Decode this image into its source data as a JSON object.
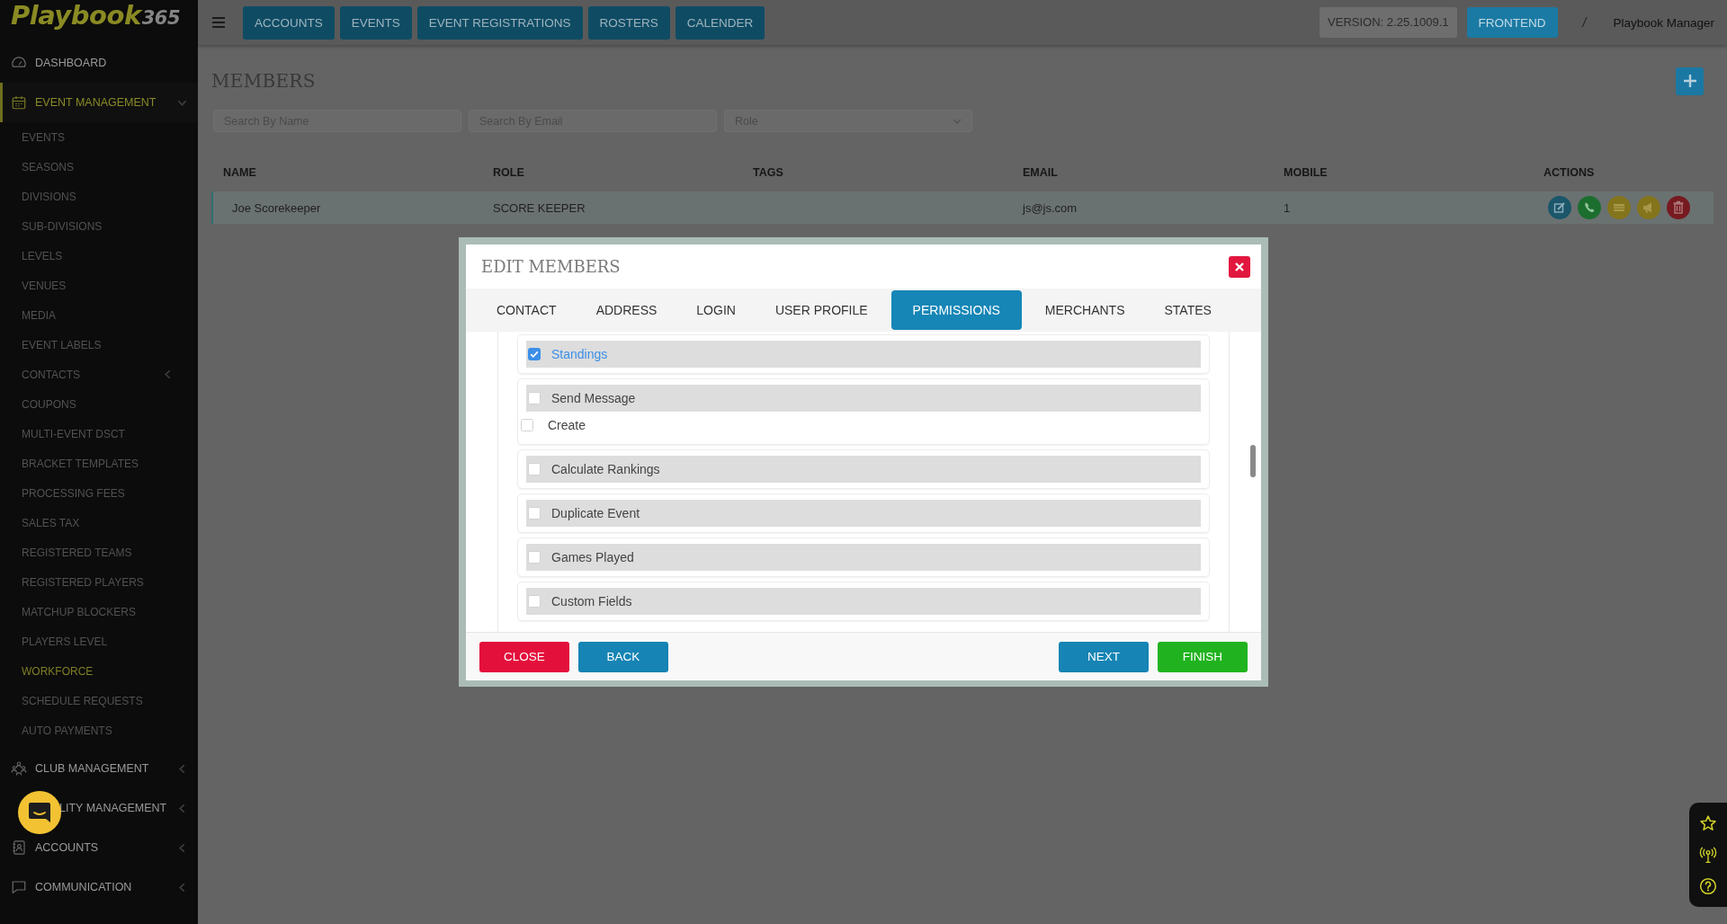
{
  "sidebar": {
    "logo": {
      "name": "Playbook",
      "number": "365"
    },
    "items": [
      {
        "kind": "link",
        "label": "DASHBOARD",
        "selected": false
      },
      {
        "kind": "group",
        "label": "EVENT MANAGEMENT",
        "selected": true,
        "expanded": true,
        "children": [
          {
            "kind": "link",
            "label": "EVENTS",
            "selected": false
          },
          {
            "kind": "link",
            "label": "SEASONS",
            "selected": false
          },
          {
            "kind": "link",
            "label": "DIVISIONS",
            "selected": false
          },
          {
            "kind": "link",
            "label": "SUB-DIVISIONS",
            "selected": false
          },
          {
            "kind": "link",
            "label": "LEVELS",
            "selected": false
          },
          {
            "kind": "link",
            "label": "VENUES",
            "selected": false
          },
          {
            "kind": "link",
            "label": "MEDIA",
            "selected": false
          },
          {
            "kind": "link",
            "label": "EVENT LABELS",
            "selected": false
          },
          {
            "kind": "group",
            "label": "CONTACTS",
            "selected": false,
            "expanded": false
          },
          {
            "kind": "link",
            "label": "COUPONS",
            "selected": false
          },
          {
            "kind": "link",
            "label": "MULTI-EVENT DSCT",
            "selected": false
          },
          {
            "kind": "link",
            "label": "BRACKET TEMPLATES",
            "selected": false
          },
          {
            "kind": "link",
            "label": "PROCESSING FEES",
            "selected": false
          },
          {
            "kind": "link",
            "label": "SALES TAX",
            "selected": false
          },
          {
            "kind": "link",
            "label": "REGISTERED TEAMS",
            "selected": false
          },
          {
            "kind": "link",
            "label": "REGISTERED PLAYERS",
            "selected": false
          },
          {
            "kind": "link",
            "label": "MATCHUP BLOCKERS",
            "selected": false
          },
          {
            "kind": "link",
            "label": "PLAYERS LEVEL",
            "selected": false
          },
          {
            "kind": "link",
            "label": "WORKFORCE",
            "selected": true
          },
          {
            "kind": "link",
            "label": "SCHEDULE REQUESTS",
            "selected": false
          },
          {
            "kind": "link",
            "label": "AUTO PAYMENTS",
            "selected": false
          }
        ]
      },
      {
        "kind": "group",
        "label": "CLUB MANAGEMENT",
        "selected": false,
        "expanded": false
      },
      {
        "kind": "group",
        "label": "LITY MANAGEMENT",
        "selected": false,
        "expanded": false
      },
      {
        "kind": "group",
        "label": "ACCOUNTS",
        "selected": false,
        "expanded": false
      },
      {
        "kind": "group",
        "label": "COMMUNICATION",
        "selected": false,
        "expanded": false
      }
    ]
  },
  "topbar": {
    "nav": [
      "ACCOUNTS",
      "EVENTS",
      "EVENT REGISTRATIONS",
      "ROSTERS",
      "CALENDER"
    ],
    "version": "VERSION: 2.25.1009.1",
    "frontend": "FRONTEND",
    "separator": "/",
    "user": "Playbook Manager"
  },
  "page": {
    "title": "MEMBERS",
    "filters": [
      {
        "kind": "text",
        "placeholder": "Search By Name"
      },
      {
        "kind": "text",
        "placeholder": "Search By Email"
      },
      {
        "kind": "select",
        "placeholder": "Role"
      }
    ],
    "table": {
      "columns": [
        "NAME",
        "ROLE",
        "TAGS",
        "EMAIL",
        "MOBILE",
        "ACTIONS"
      ],
      "rows": [
        {
          "selected": true,
          "name": "Joe Scorekeeper",
          "role": "SCORE KEEPER",
          "email": "js@js.com",
          "mobile": "1"
        }
      ]
    }
  },
  "modal": {
    "title": "EDIT MEMBERS",
    "tabs": [
      {
        "label": "CONTACT",
        "selected": false
      },
      {
        "label": "ADDRESS",
        "selected": false
      },
      {
        "label": "LOGIN",
        "selected": false
      },
      {
        "label": "USER PROFILE",
        "selected": false
      },
      {
        "label": "PERMISSIONS",
        "selected": true
      },
      {
        "label": "MERCHANTS",
        "selected": false
      },
      {
        "label": "STATES",
        "selected": false
      }
    ],
    "permissions": [
      {
        "label": "Standings",
        "checked": true
      },
      {
        "label": "Send Message",
        "checked": false,
        "children": [
          {
            "label": "Create",
            "checked": false
          }
        ]
      },
      {
        "label": "Calculate Rankings",
        "checked": false
      },
      {
        "label": "Duplicate Event",
        "checked": false
      },
      {
        "label": "Games Played",
        "checked": false
      },
      {
        "label": "Custom Fields",
        "checked": false
      }
    ],
    "buttons": [
      {
        "kind": "close",
        "label": "CLOSE"
      },
      {
        "kind": "back",
        "label": "BACK"
      },
      {
        "kind": "next",
        "label": "NEXT"
      },
      {
        "kind": "finish",
        "label": "FINISH"
      }
    ]
  }
}
